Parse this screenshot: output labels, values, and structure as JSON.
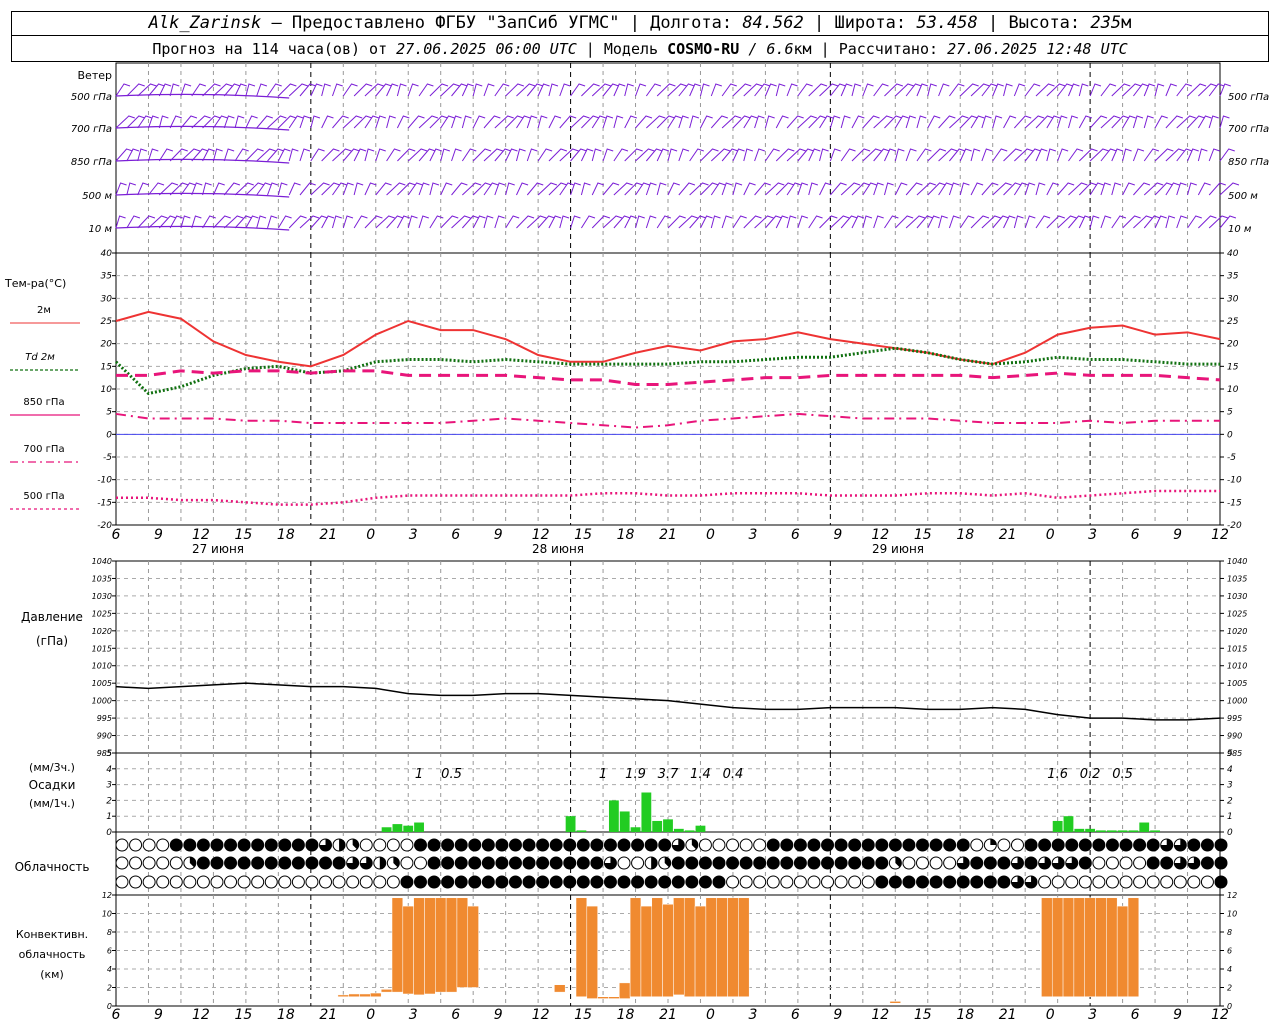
{
  "header": {
    "station": "Alk_Zarinsk",
    "provider": "– Предоставлено ФГБУ \"ЗапСиб УГМС\"",
    "lon_label": "Долгота:",
    "lon": "84.562",
    "lat_label": "Широта:",
    "lat": "53.458",
    "alt_label": "Высота:",
    "alt": "235",
    "alt_unit": "м",
    "forecast_label": "Прогноз на 114 часа(ов) от",
    "forecast_from": "27.06.2025 06:00 UTC",
    "model_label": "Модель",
    "model": "COSMO-RU",
    "resolution": "/ 6.6",
    "resolution_unit": "км",
    "computed_label": "Рассчитано:",
    "computed": "27.06.2025 12:48 UTC"
  },
  "time_axis": {
    "hour_labels": [
      "6",
      "9",
      "12",
      "15",
      "18",
      "21",
      "0",
      "3",
      "6",
      "9",
      "12",
      "15",
      "18",
      "21",
      "0",
      "3",
      "6",
      "9",
      "12",
      "15",
      "18",
      "21",
      "0",
      "3",
      "6",
      "9",
      "12"
    ],
    "day_labels": [
      "27 июня",
      "28 июня",
      "29 июня"
    ]
  },
  "colors": {
    "wind": "#7b1fd6",
    "t2m": "#ee3333",
    "td2m": "#107010",
    "t850": "#e8157a",
    "precip": "#22cc22",
    "conv": "#f08a30",
    "zero_line": "#4444ee",
    "pressure": "#000000"
  },
  "chart_data": [
    {
      "type": "wind_barbs",
      "panel_label": "Ветер",
      "levels": [
        "500 гПа",
        "700 гПа",
        "850 гПа",
        "500 м",
        "10  м"
      ]
    },
    {
      "type": "line",
      "panel_label": "Тем-ра(°C)",
      "ylim": [
        -20,
        40
      ],
      "y_ticks": [
        40,
        35,
        30,
        25,
        20,
        15,
        10,
        5,
        0,
        -5,
        -10,
        -15,
        -20
      ],
      "x_hours": [
        0,
        3,
        6,
        9,
        12,
        15,
        18,
        21,
        24,
        27,
        30,
        33,
        36,
        39,
        42,
        45,
        48,
        51,
        54,
        57,
        60,
        63,
        66,
        69,
        72,
        75,
        78,
        81,
        84,
        87,
        90,
        93,
        96,
        99,
        102
      ],
      "series": [
        {
          "name": "2м",
          "values": [
            25,
            27,
            25.5,
            20.5,
            17.5,
            16,
            15,
            17.5,
            22,
            25,
            23,
            23,
            21,
            17.5,
            16,
            16,
            18,
            19.5,
            18.5,
            20.5,
            21,
            22.5,
            21,
            20,
            19,
            18,
            16.5,
            15.5,
            18,
            22,
            23.5,
            24,
            22,
            22.5,
            21
          ]
        },
        {
          "name": "Td 2м",
          "values": [
            16,
            9,
            10.5,
            13,
            14.5,
            15,
            13.5,
            14,
            16,
            16.5,
            16.5,
            16,
            16.5,
            16,
            15.5,
            15.5,
            15.5,
            15.5,
            16,
            16,
            16.5,
            17,
            17,
            18,
            19,
            18,
            16.5,
            15.5,
            16,
            17,
            16.5,
            16.5,
            16,
            15.5,
            15.5
          ]
        },
        {
          "name": "850 гПа",
          "values": [
            13,
            13,
            14,
            13.5,
            14,
            14,
            13.5,
            14,
            14,
            13,
            13,
            13,
            13,
            12.5,
            12,
            12,
            11,
            11,
            11.5,
            12,
            12.5,
            12.5,
            13,
            13,
            13,
            13,
            13,
            12.5,
            13,
            13.5,
            13,
            13,
            13,
            12.5,
            12
          ]
        },
        {
          "name": "700 гПа",
          "values": [
            4.5,
            3.5,
            3.5,
            3.5,
            3,
            3,
            2.5,
            2.5,
            2.5,
            2.5,
            2.5,
            3,
            3.5,
            3,
            2.5,
            2,
            1.5,
            2,
            3,
            3.5,
            4,
            4.5,
            4,
            3.5,
            3.5,
            3.5,
            3,
            2.5,
            2.5,
            2.5,
            3,
            2.5,
            3,
            3,
            3
          ]
        },
        {
          "name": "500 гПа",
          "values": [
            -14,
            -14,
            -14.5,
            -14.5,
            -15,
            -15.5,
            -15.5,
            -15,
            -14,
            -13.5,
            -13.5,
            -13.5,
            -13.5,
            -13.5,
            -13.5,
            -13,
            -13,
            -13.5,
            -13.5,
            -13,
            -13,
            -13,
            -13.5,
            -13.5,
            -13.5,
            -13,
            -13,
            -13.5,
            -13,
            -14,
            -13.5,
            -13,
            -12.5,
            -12.5,
            -12.5
          ]
        }
      ]
    },
    {
      "type": "line",
      "panel_label": "Давление",
      "unit_label": "(гПа)",
      "ylim": [
        985,
        1040
      ],
      "y_ticks": [
        1040,
        1035,
        1030,
        1025,
        1020,
        1015,
        1010,
        1005,
        1000,
        995,
        990,
        985
      ],
      "x_hours": [
        0,
        3,
        6,
        9,
        12,
        15,
        18,
        21,
        24,
        27,
        30,
        33,
        36,
        39,
        42,
        45,
        48,
        51,
        54,
        57,
        60,
        63,
        66,
        69,
        72,
        75,
        78,
        81,
        84,
        87,
        90,
        93,
        96,
        99,
        102
      ],
      "series": [
        {
          "name": "pressure",
          "values": [
            1004,
            1003.5,
            1004,
            1004.5,
            1005,
            1004.5,
            1004,
            1004,
            1003.5,
            1002,
            1001.5,
            1001.5,
            1002,
            1002,
            1001.5,
            1001,
            1000.5,
            1000,
            999,
            998,
            997.5,
            997.5,
            998,
            998,
            998,
            997.5,
            997.5,
            998,
            997.5,
            996,
            995,
            995,
            994.5,
            994.5,
            995
          ]
        }
      ]
    },
    {
      "type": "bar",
      "panel_label": "Осадки",
      "unit_top": "(мм/3ч.)",
      "unit_bottom": "(мм/1ч.)",
      "ylim": [
        0,
        5
      ],
      "y_ticks": [
        5,
        4,
        3,
        2,
        1,
        0
      ],
      "x_hours": [
        25,
        26,
        27,
        28,
        42,
        43,
        46,
        47,
        48,
        49,
        50,
        51,
        52,
        53,
        54,
        87,
        88,
        89,
        90,
        91,
        92,
        93,
        94,
        95,
        96
      ],
      "values": [
        0.3,
        0.5,
        0.4,
        0.6,
        1,
        0.1,
        2,
        1.3,
        0.3,
        2.5,
        0.7,
        0.8,
        0.2,
        0.1,
        0.4,
        0.7,
        1,
        0.2,
        0.2,
        0.1,
        0.1,
        0.1,
        0.1,
        0.6,
        0.1
      ],
      "totals_3h": [
        {
          "hour": 28,
          "label": "1"
        },
        {
          "hour": 31,
          "label": "0.5"
        },
        {
          "hour": 45,
          "label": "1"
        },
        {
          "hour": 48,
          "label": "1.9"
        },
        {
          "hour": 51,
          "label": "3.7"
        },
        {
          "hour": 54,
          "label": "1.4"
        },
        {
          "hour": 57,
          "label": "0.4"
        },
        {
          "hour": 87,
          "label": "1.6"
        },
        {
          "hour": 90,
          "label": "0.2"
        },
        {
          "hour": 93,
          "label": "0.5"
        }
      ]
    },
    {
      "type": "cloud_symbols",
      "panel_label": "Облачность",
      "rows": [
        "0000888888888886430000888888888888888888863000008888888888888880200888888888866888",
        "0000038888888888866430088888888888886004388888888888888883000068886866680000886688",
        "0000000000000000000008888888888888888888888880000000000088888888886600000000000008"
      ]
    },
    {
      "type": "bar",
      "panel_label": "Конвективн. облачность (км)",
      "ylim": [
        0,
        12
      ],
      "y_ticks": [
        12,
        10,
        8,
        6,
        4,
        2,
        0
      ],
      "bars": [
        {
          "hour": 21,
          "bottom": 1,
          "top": 1.2
        },
        {
          "hour": 22,
          "bottom": 1,
          "top": 1.3
        },
        {
          "hour": 23,
          "bottom": 1,
          "top": 1.3
        },
        {
          "hour": 24,
          "bottom": 1,
          "top": 1.4
        },
        {
          "hour": 25,
          "bottom": 1.5,
          "top": 1.8
        },
        {
          "hour": 26,
          "bottom": 1.5,
          "top": 11.7
        },
        {
          "hour": 27,
          "bottom": 1.3,
          "top": 10.8
        },
        {
          "hour": 28,
          "bottom": 1.2,
          "top": 11.7
        },
        {
          "hour": 29,
          "bottom": 1.3,
          "top": 11.7
        },
        {
          "hour": 30,
          "bottom": 1.5,
          "top": 11.7
        },
        {
          "hour": 31,
          "bottom": 1.5,
          "top": 11.7
        },
        {
          "hour": 32,
          "bottom": 2,
          "top": 11.7
        },
        {
          "hour": 33,
          "bottom": 2,
          "top": 10.8
        },
        {
          "hour": 41,
          "bottom": 1.5,
          "top": 2.3
        },
        {
          "hour": 43,
          "bottom": 1,
          "top": 11.7
        },
        {
          "hour": 44,
          "bottom": 0.8,
          "top": 10.8
        },
        {
          "hour": 45,
          "bottom": 0.8,
          "top": 1
        },
        {
          "hour": 46,
          "bottom": 0.8,
          "top": 1
        },
        {
          "hour": 47,
          "bottom": 0.8,
          "top": 2.5
        },
        {
          "hour": 48,
          "bottom": 1,
          "top": 11.7
        },
        {
          "hour": 49,
          "bottom": 1,
          "top": 10.8
        },
        {
          "hour": 50,
          "bottom": 1,
          "top": 11.7
        },
        {
          "hour": 51,
          "bottom": 1,
          "top": 11
        },
        {
          "hour": 52,
          "bottom": 1.2,
          "top": 11.7
        },
        {
          "hour": 53,
          "bottom": 1,
          "top": 11.7
        },
        {
          "hour": 54,
          "bottom": 1,
          "top": 10.8
        },
        {
          "hour": 55,
          "bottom": 1,
          "top": 11.7
        },
        {
          "hour": 56,
          "bottom": 1,
          "top": 11.7
        },
        {
          "hour": 57,
          "bottom": 1,
          "top": 11.7
        },
        {
          "hour": 58,
          "bottom": 1,
          "top": 11.7
        },
        {
          "hour": 72,
          "bottom": 0.3,
          "top": 0.5
        },
        {
          "hour": 86,
          "bottom": 1,
          "top": 11.7
        },
        {
          "hour": 87,
          "bottom": 1,
          "top": 11.7
        },
        {
          "hour": 88,
          "bottom": 1,
          "top": 11.7
        },
        {
          "hour": 89,
          "bottom": 1,
          "top": 11.7
        },
        {
          "hour": 90,
          "bottom": 1,
          "top": 11.7
        },
        {
          "hour": 91,
          "bottom": 1,
          "top": 11.7
        },
        {
          "hour": 92,
          "bottom": 1,
          "top": 11.7
        },
        {
          "hour": 93,
          "bottom": 1,
          "top": 10.8
        },
        {
          "hour": 94,
          "bottom": 1,
          "top": 11.7
        }
      ]
    }
  ]
}
